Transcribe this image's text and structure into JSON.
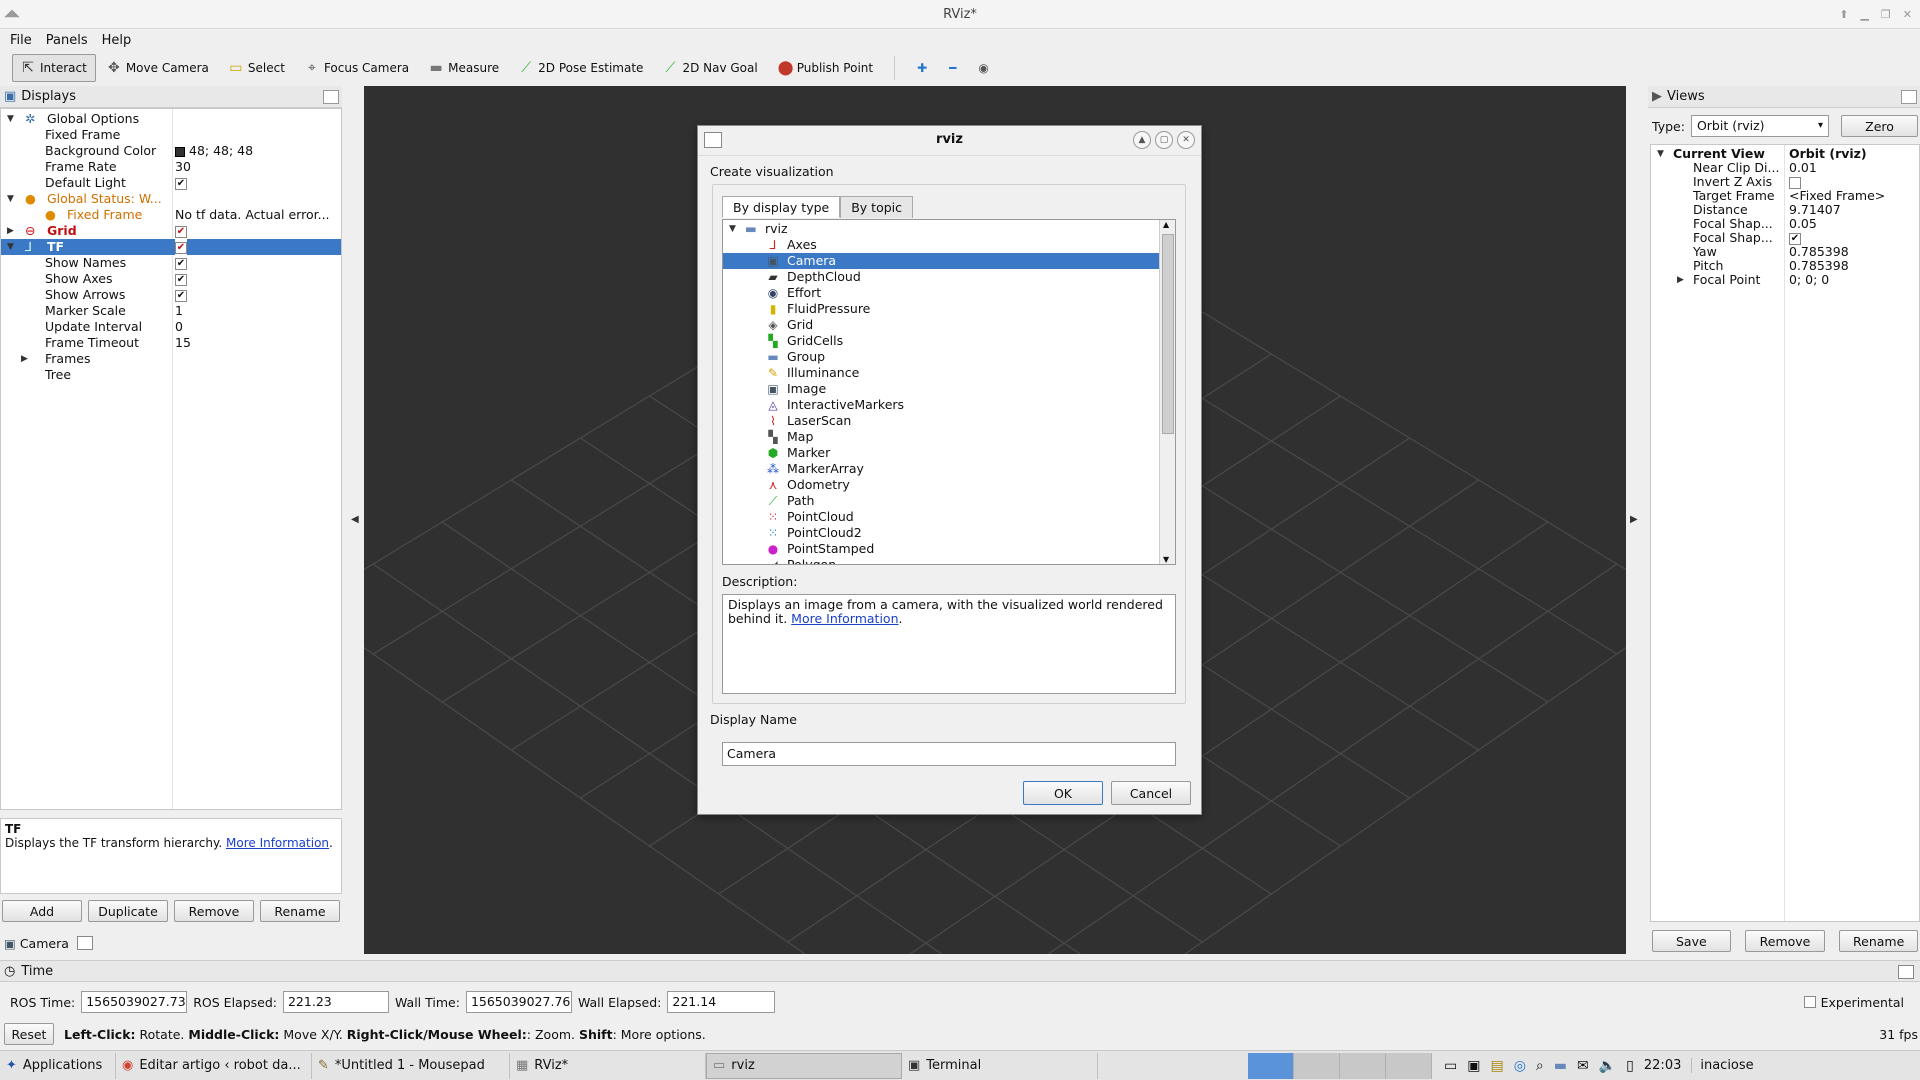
{
  "window": {
    "title": "RViz*"
  },
  "menu": [
    "File",
    "Panels",
    "Help"
  ],
  "toolbar": {
    "tools": [
      {
        "label": "Interact",
        "icon": "cursor-icon",
        "glyph": "⇱",
        "active": true,
        "color": "#333333"
      },
      {
        "label": "Move Camera",
        "icon": "move-camera-icon",
        "glyph": "✥",
        "active": false,
        "color": "#555555"
      },
      {
        "label": "Select",
        "icon": "select-icon",
        "glyph": "▭",
        "active": false,
        "color": "#c9a400"
      },
      {
        "label": "Focus Camera",
        "icon": "focus-camera-icon",
        "glyph": "⌖",
        "active": false,
        "color": "#555555"
      },
      {
        "label": "Measure",
        "icon": "measure-icon",
        "glyph": "▬",
        "active": false,
        "color": "#777777"
      },
      {
        "label": "2D Pose Estimate",
        "icon": "pose-estimate-icon",
        "glyph": "⟋",
        "active": false,
        "color": "#2eb82e"
      },
      {
        "label": "2D Nav Goal",
        "icon": "nav-goal-icon",
        "glyph": "⟋",
        "active": false,
        "color": "#2eb82e"
      },
      {
        "label": "Publish Point",
        "icon": "publish-point-icon",
        "glyph": "⬤",
        "active": false,
        "color": "#c0392b"
      }
    ]
  },
  "displays": {
    "title": "Displays",
    "rows": [
      {
        "key": "Global Options",
        "value": "",
        "level": 1,
        "arrow": "open",
        "icon": "gear-icon",
        "style": ""
      },
      {
        "key": "Fixed Frame",
        "value": "",
        "level": 2,
        "style": ""
      },
      {
        "key": "Background Color",
        "value": "48; 48; 48",
        "level": 2,
        "swatch": "#303030",
        "style": ""
      },
      {
        "key": "Frame Rate",
        "value": "30",
        "level": 2,
        "style": ""
      },
      {
        "key": "Default Light",
        "value": "✔",
        "level": 2,
        "check": true,
        "style": ""
      },
      {
        "key": "Global Status: W...",
        "value": "",
        "level": 1,
        "arrow": "open",
        "icon": "warning-icon",
        "style": "warn"
      },
      {
        "key": "Fixed Frame",
        "value": "No tf data.  Actual error...",
        "level": 2,
        "icon": "warning-icon",
        "style": "warn"
      },
      {
        "key": "Grid",
        "value": "✔",
        "level": 1,
        "arrow": "closed",
        "icon": "error-icon",
        "check": true,
        "style": "error"
      },
      {
        "key": "TF",
        "value": "✔",
        "level": 1,
        "arrow": "open",
        "icon": "tf-icon",
        "check": true,
        "style": "errorsel"
      },
      {
        "key": "Show Names",
        "value": "✔",
        "level": 2,
        "check": true,
        "style": ""
      },
      {
        "key": "Show Axes",
        "value": "✔",
        "level": 2,
        "check": true,
        "style": ""
      },
      {
        "key": "Show Arrows",
        "value": "✔",
        "level": 2,
        "check": true,
        "style": ""
      },
      {
        "key": "Marker Scale",
        "value": "1",
        "level": 2,
        "style": ""
      },
      {
        "key": "Update Interval",
        "value": "0",
        "level": 2,
        "style": ""
      },
      {
        "key": "Frame Timeout",
        "value": "15",
        "level": 2,
        "style": ""
      },
      {
        "key": "Frames",
        "value": "",
        "level": 2,
        "arrow": "closed",
        "style": ""
      },
      {
        "key": "Tree",
        "value": "",
        "level": 2,
        "style": ""
      }
    ],
    "desc_title": "TF",
    "desc_text": "Displays the TF transform hierarchy. ",
    "desc_link": "More Information",
    "desc_after": ".",
    "buttons": [
      "Add",
      "Duplicate",
      "Remove",
      "Rename"
    ],
    "camera_tab": "Camera"
  },
  "dialog": {
    "title": "rviz",
    "section": "Create visualization",
    "tabs": [
      "By display type",
      "By topic"
    ],
    "root": "rviz",
    "items": [
      {
        "label": "Axes",
        "icon": "axes-icon",
        "glyph": "⅃",
        "color": "#cc2222"
      },
      {
        "label": "Camera",
        "icon": "camera-icon",
        "glyph": "▣",
        "color": "#445566",
        "selected": true
      },
      {
        "label": "DepthCloud",
        "icon": "depth-cloud-icon",
        "glyph": "▰",
        "color": "#333333"
      },
      {
        "label": "Effort",
        "icon": "effort-icon",
        "glyph": "◉",
        "color": "#334466"
      },
      {
        "label": "FluidPressure",
        "icon": "fluid-pressure-icon",
        "glyph": "▮",
        "color": "#d4b400"
      },
      {
        "label": "Grid",
        "icon": "grid-icon",
        "glyph": "◈",
        "color": "#555555"
      },
      {
        "label": "GridCells",
        "icon": "grid-cells-icon",
        "glyph": "▚",
        "color": "#22aa22"
      },
      {
        "label": "Group",
        "icon": "folder-icon",
        "glyph": "▬",
        "color": "#6688bb"
      },
      {
        "label": "Illuminance",
        "icon": "illuminance-icon",
        "glyph": "✎",
        "color": "#d4a000"
      },
      {
        "label": "Image",
        "icon": "image-icon",
        "glyph": "▣",
        "color": "#445566"
      },
      {
        "label": "InteractiveMarkers",
        "icon": "interactive-markers-icon",
        "glyph": "◬",
        "color": "#553399"
      },
      {
        "label": "LaserScan",
        "icon": "laser-scan-icon",
        "glyph": "⌇",
        "color": "#cc2222"
      },
      {
        "label": "Map",
        "icon": "map-icon",
        "glyph": "▚",
        "color": "#555555"
      },
      {
        "label": "Marker",
        "icon": "marker-icon",
        "glyph": "⬢",
        "color": "#22aa22"
      },
      {
        "label": "MarkerArray",
        "icon": "marker-array-icon",
        "glyph": "⁂",
        "color": "#2255cc"
      },
      {
        "label": "Odometry",
        "icon": "odometry-icon",
        "glyph": "⋏",
        "color": "#cc2222"
      },
      {
        "label": "Path",
        "icon": "path-icon",
        "glyph": "⟋",
        "color": "#22aa22"
      },
      {
        "label": "PointCloud",
        "icon": "point-cloud-icon",
        "glyph": "⁙",
        "color": "#cc2222"
      },
      {
        "label": "PointCloud2",
        "icon": "point-cloud2-icon",
        "glyph": "⁙",
        "color": "#2277cc"
      },
      {
        "label": "PointStamped",
        "icon": "point-stamped-icon",
        "glyph": "●",
        "color": "#cc22cc"
      },
      {
        "label": "Polygon",
        "icon": "polygon-icon",
        "glyph": "◢",
        "color": "#333333"
      }
    ],
    "desc_label": "Description:",
    "desc_text": "Displays an image from a camera, with the visualized world rendered behind it. ",
    "desc_link": "More Information",
    "desc_after": ".",
    "name_label": "Display Name",
    "name_value": "Camera",
    "ok": "OK",
    "cancel": "Cancel"
  },
  "views": {
    "title": "Views",
    "type_label": "Type:",
    "type_value": "Orbit (rviz)",
    "zero": "Zero",
    "current_key": "Current View",
    "current_value": "Orbit (rviz)",
    "rows": [
      {
        "key": "Near Clip Di...",
        "value": "0.01"
      },
      {
        "key": "Invert Z Axis",
        "value": "",
        "check": true,
        "checked": false
      },
      {
        "key": "Target Frame",
        "value": "<Fixed Frame>"
      },
      {
        "key": "Distance",
        "value": "9.71407"
      },
      {
        "key": "Focal Shap...",
        "value": "0.05"
      },
      {
        "key": "Focal Shap...",
        "value": "✔",
        "check": true,
        "checked": true
      },
      {
        "key": "Yaw",
        "value": "0.785398"
      },
      {
        "key": "Pitch",
        "value": "0.785398"
      },
      {
        "key": "Focal Point",
        "value": "0; 0; 0",
        "arrow": true
      }
    ],
    "buttons": [
      "Save",
      "Remove",
      "Rename"
    ]
  },
  "time": {
    "title": "Time",
    "ros_time_label": "ROS Time:",
    "ros_time": "1565039027.73",
    "ros_elapsed_label": "ROS Elapsed:",
    "ros_elapsed": "221.23",
    "wall_time_label": "Wall Time:",
    "wall_time": "1565039027.76",
    "wall_elapsed_label": "Wall Elapsed:",
    "wall_elapsed": "221.14",
    "experimental": "Experimental"
  },
  "status": {
    "reset": "Reset",
    "b1": "Left-Click:",
    "t1": " Rotate. ",
    "b2": "Middle-Click:",
    "t2": " Move X/Y. ",
    "b3": "Right-Click/Mouse Wheel:",
    "t3": ": Zoom. ",
    "b4": "Shift",
    "t4": ": More options.",
    "fps": "31 fps"
  },
  "taskbar": {
    "apps": "Applications",
    "tasks": [
      {
        "label": "Editar artigo ‹ robot da...",
        "icon": "browser-icon",
        "glyph": "◉",
        "color": "#d0452e"
      },
      {
        "label": "*Untitled 1 - Mousepad",
        "icon": "editor-icon",
        "glyph": "✎",
        "color": "#8a6d2e"
      },
      {
        "label": "RViz*",
        "icon": "rviz-icon",
        "glyph": "▦",
        "color": "#777777"
      },
      {
        "label": "rviz",
        "icon": "rviz-dialog-icon",
        "glyph": "▭",
        "color": "#777777",
        "active": true
      },
      {
        "label": "Terminal",
        "icon": "terminal-icon",
        "glyph": "▣",
        "color": "#333333"
      }
    ],
    "clock": "22:03",
    "user": "inaciose"
  }
}
